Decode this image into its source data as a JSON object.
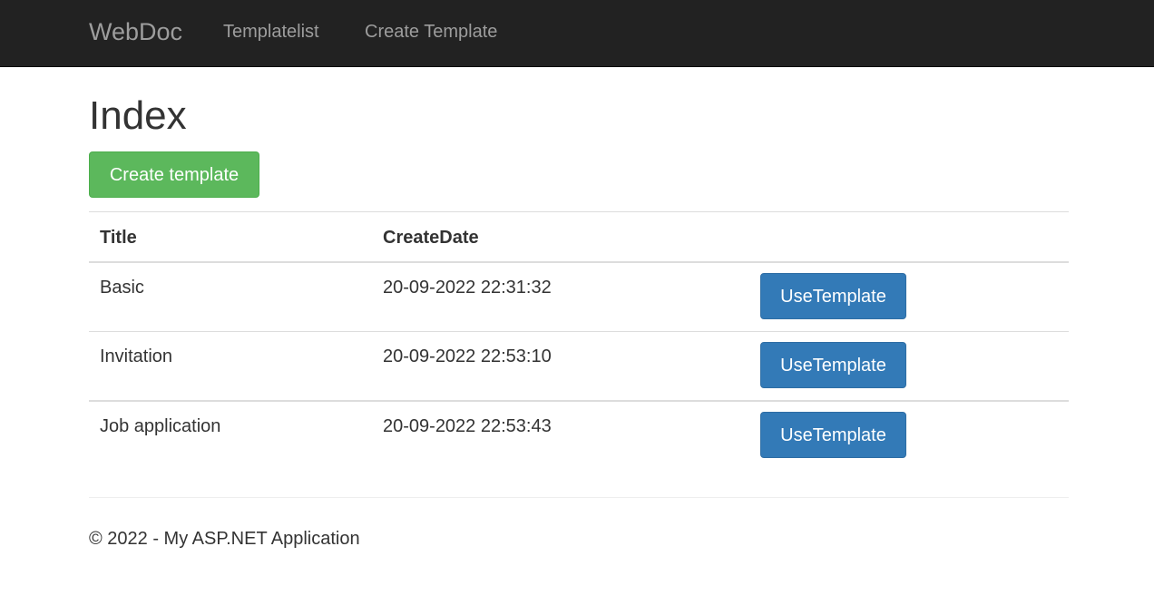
{
  "navbar": {
    "brand": "WebDoc",
    "links": [
      {
        "label": "Templatelist"
      },
      {
        "label": "Create Template"
      }
    ]
  },
  "main": {
    "title": "Index",
    "create_button": "Create template",
    "table": {
      "headers": [
        "Title",
        "CreateDate",
        ""
      ],
      "rows": [
        {
          "title": "Basic",
          "create_date": "20-09-2022 22:31:32",
          "action": "UseTemplate"
        },
        {
          "title": "Invitation",
          "create_date": "20-09-2022 22:53:10",
          "action": "UseTemplate"
        },
        {
          "title": "Job application",
          "create_date": "20-09-2022 22:53:43",
          "action": "UseTemplate"
        }
      ]
    }
  },
  "footer": {
    "text": "© 2022 - My ASP.NET Application"
  },
  "colors": {
    "navbar_bg": "#222222",
    "nav_text": "#9d9d9d",
    "success": "#5cb85c",
    "primary": "#337ab7"
  }
}
